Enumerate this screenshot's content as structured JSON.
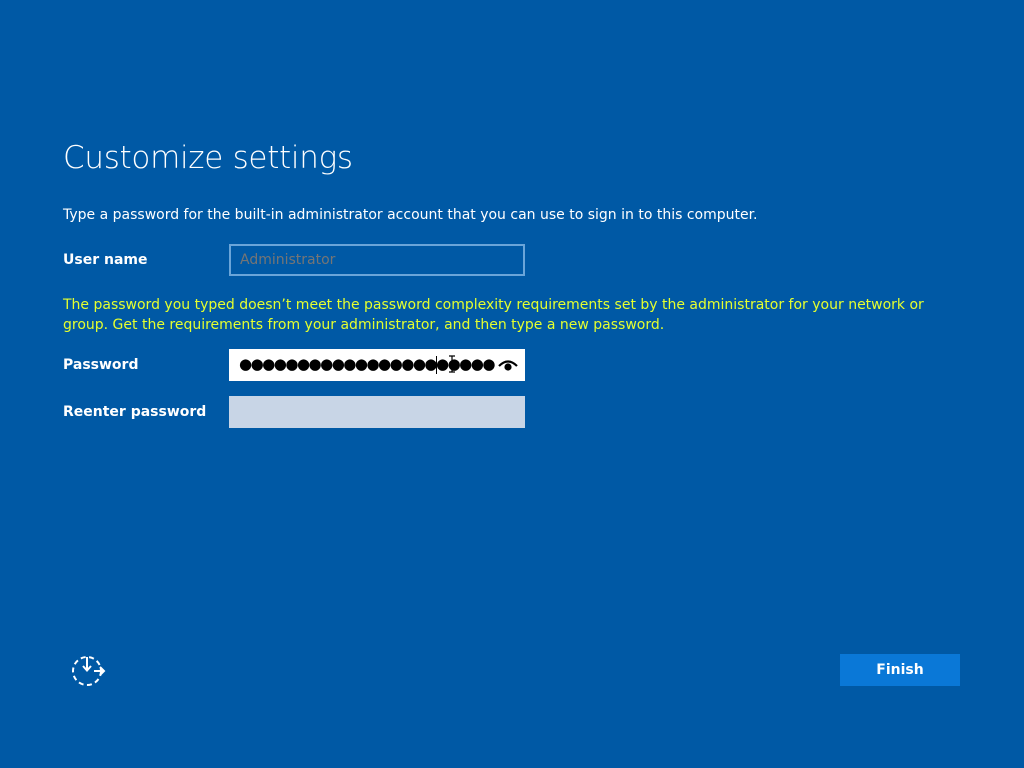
{
  "page": {
    "title": "Customize settings",
    "intro": "Type a password for the built-in administrator account that you can use to sign in to this computer."
  },
  "form": {
    "username_label": "User name",
    "username_placeholder": "Administrator",
    "warning": "The password you typed doesn’t meet the password complexity requirements set by the administrator for your network or group. Get the requirements from your administrator, and then type a new password.",
    "password_label": "Password",
    "password_masked": "●●●●●●●●●●●●●●●●●●●●●●",
    "reveal_icon": "eye-icon",
    "reenter_label": "Reenter password",
    "reenter_value": ""
  },
  "footer": {
    "accessibility_icon": "ease-of-access-icon",
    "finish_label": "Finish"
  },
  "colors": {
    "background": "#0059a5",
    "warning": "#e5ff2e",
    "button": "#0a78d7",
    "reenter_field": "#c8d5e6"
  }
}
